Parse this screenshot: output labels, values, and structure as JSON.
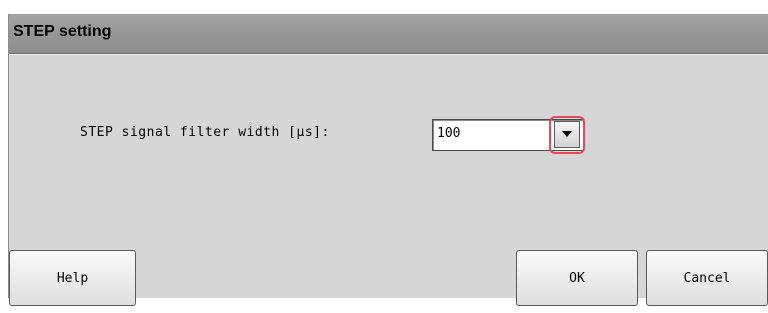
{
  "window": {
    "title": "STEP setting"
  },
  "form": {
    "label": "STEP signal filter width [μs]:",
    "selected_value": "100",
    "highlight_color": "#e8475e"
  },
  "buttons": {
    "help_label": "Help",
    "ok_label": "OK",
    "cancel_label": "Cancel"
  },
  "icons": {
    "dropdown": "chevron-down-icon"
  },
  "colors": {
    "window_background": "#d6d6d6",
    "titlebar": "#8c8c8c"
  }
}
